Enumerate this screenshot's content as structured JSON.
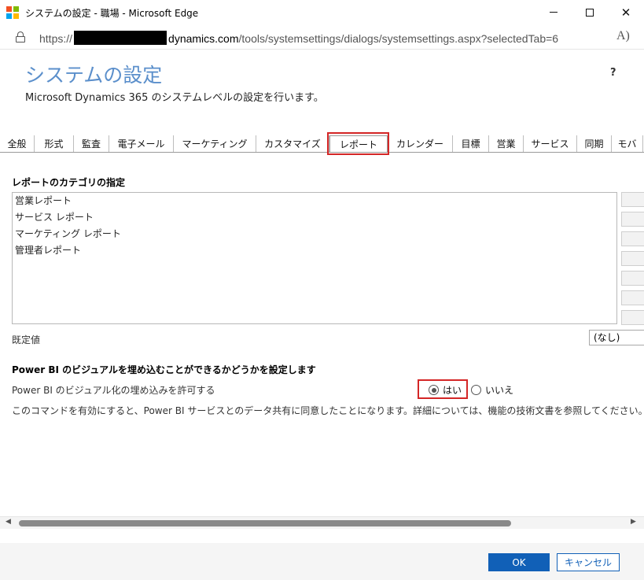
{
  "window": {
    "title": "システムの設定 - 職場 - Microsoft Edge",
    "minimize": "—",
    "close": "✕"
  },
  "address": {
    "prefix": "https://",
    "host": "dynamics.com",
    "path": "/tools/systemsettings/dialogs/systemsettings.aspx?selectedTab=6",
    "read_aloud": "A)"
  },
  "header": {
    "title": "システムの設定",
    "subtitle": "Microsoft Dynamics 365 のシステムレベルの設定を行います。",
    "help": "?"
  },
  "tabs": [
    "全般",
    "形式",
    "監査",
    "電子メール",
    "マーケティング",
    "カスタマイズ",
    "レポート",
    "カレンダー",
    "目標",
    "営業",
    "サービス",
    "同期",
    "モバ"
  ],
  "active_tab_index": 6,
  "report_categories": {
    "title": "レポートのカテゴリの指定",
    "items": [
      "営業レポート",
      "サービス レポート",
      "マーケティング レポート",
      "管理者レポート"
    ],
    "default_label": "既定値",
    "default_value": "(なし)"
  },
  "powerbi": {
    "title": "Power BI のビジュアルを埋め込むことができるかどうかを設定します",
    "setting_label": "Power BI のビジュアル化の埋め込みを許可する",
    "yes": "はい",
    "no": "いいえ",
    "selected": "yes",
    "note": "このコマンドを有効にすると、Power BI サービスとのデータ共有に同意したことになります。詳細については、機能の技術文書を参照してください。"
  },
  "footer": {
    "ok": "OK",
    "cancel": "キャンセル"
  },
  "colors": {
    "accent": "#1160b7",
    "title_blue": "#5b8fcb",
    "highlight_red": "#d42626"
  }
}
